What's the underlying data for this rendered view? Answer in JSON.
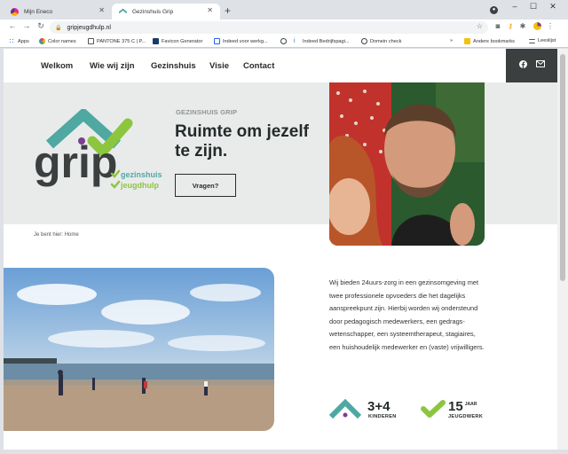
{
  "browser": {
    "tabs": [
      {
        "title": "Mijn Eneco",
        "active": false
      },
      {
        "title": "Gezinshuis Grip",
        "active": true
      }
    ],
    "url": "gripjeugdhulp.nl",
    "bookmarks": [
      {
        "label": "Apps",
        "icon": "apps-grid-icon"
      },
      {
        "label": "Color names",
        "icon": "color-wheel-icon"
      },
      {
        "label": "PANTONE 375 C | P...",
        "icon": "pantone-icon"
      },
      {
        "label": "Favicon Generator",
        "icon": "favicon-icon"
      },
      {
        "label": "Indeed voor werkg...",
        "icon": "indeed-icon"
      },
      {
        "label": "",
        "icon": "globe-icon"
      },
      {
        "label": "Indeed Bedrijfspagi...",
        "icon": "indeed-icon"
      },
      {
        "label": "Domein check",
        "icon": "globe-icon"
      }
    ],
    "more_bookmarks": "»",
    "other_bookmarks": "Andere bookmarks",
    "reading_list": "Leeslijst"
  },
  "site": {
    "nav": [
      "Welkom",
      "Wie wij zijn",
      "Gezinshuis",
      "Visie",
      "Contact"
    ],
    "social_icons": [
      "facebook-icon",
      "mail-icon"
    ],
    "logo": {
      "word": "grip",
      "line1": "gezinshuis",
      "line2": "jeugdhulp"
    },
    "hero": {
      "kicker": "GEZINSHUIS GRIP",
      "headline": "Ruimte om jezelf te zijn.",
      "cta": "Vragen?"
    },
    "breadcrumb": {
      "prefix": "Je bent hier:",
      "current": "Home"
    },
    "intro": "Wij bieden 24uurs-zorg in een gezinsomgeving met twee professionele opvoeders die het dagelijks aanspreekpunt zijn. Hierbij worden wij ondersteund door pedagogisch medewerkers, een gedrags-wetenschapper, een systeemtherapeut, stagiaires, een huishoudelijk medewerker en (vaste) vrijwilligers.",
    "stats": [
      {
        "value": "3+4",
        "label": "KINDEREN",
        "sup": ""
      },
      {
        "value": "15",
        "label": "JEUGDWERK",
        "sup": "JAAR"
      }
    ]
  },
  "colors": {
    "brand_teal": "#4fa8a2",
    "brand_green": "#8cc63f",
    "brand_purple": "#7b3f8f",
    "brand_dark": "#3b3f3f",
    "hero_bg": "#e9ebeb"
  }
}
